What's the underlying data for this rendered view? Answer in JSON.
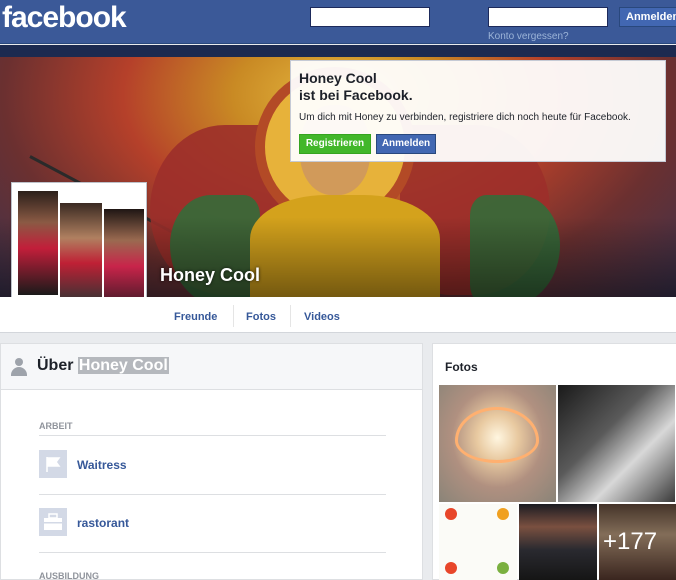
{
  "header": {
    "logo": "facebook",
    "login_button": "Anmelden",
    "forgot_link": "Konto vergessen?"
  },
  "login_prompt": {
    "title_line1": "Honey Cool",
    "title_line2": "ist bei Facebook.",
    "text": "Um dich mit Honey zu verbinden, registriere dich noch heute für Facebook.",
    "register_button": "Registrieren",
    "login_button": "Anmelden"
  },
  "profile": {
    "name": "Honey Cool"
  },
  "tabs": [
    {
      "label": "Freunde"
    },
    {
      "label": "Fotos"
    },
    {
      "label": "Videos"
    }
  ],
  "about": {
    "title_prefix": "Über",
    "title_name": "Honey Cool",
    "sections": {
      "work_label": "ARBEIT",
      "work_items": [
        {
          "label": "Waitress",
          "icon": "flag-icon"
        },
        {
          "label": "rastorant",
          "icon": "briefcase-icon"
        }
      ],
      "education_label": "AUSBILDUNG"
    }
  },
  "photos": {
    "title": "Fotos",
    "more_count": "+177"
  },
  "colors": {
    "brand": "#3b5998",
    "register_green": "#42b72a",
    "link_blue": "#365899"
  }
}
